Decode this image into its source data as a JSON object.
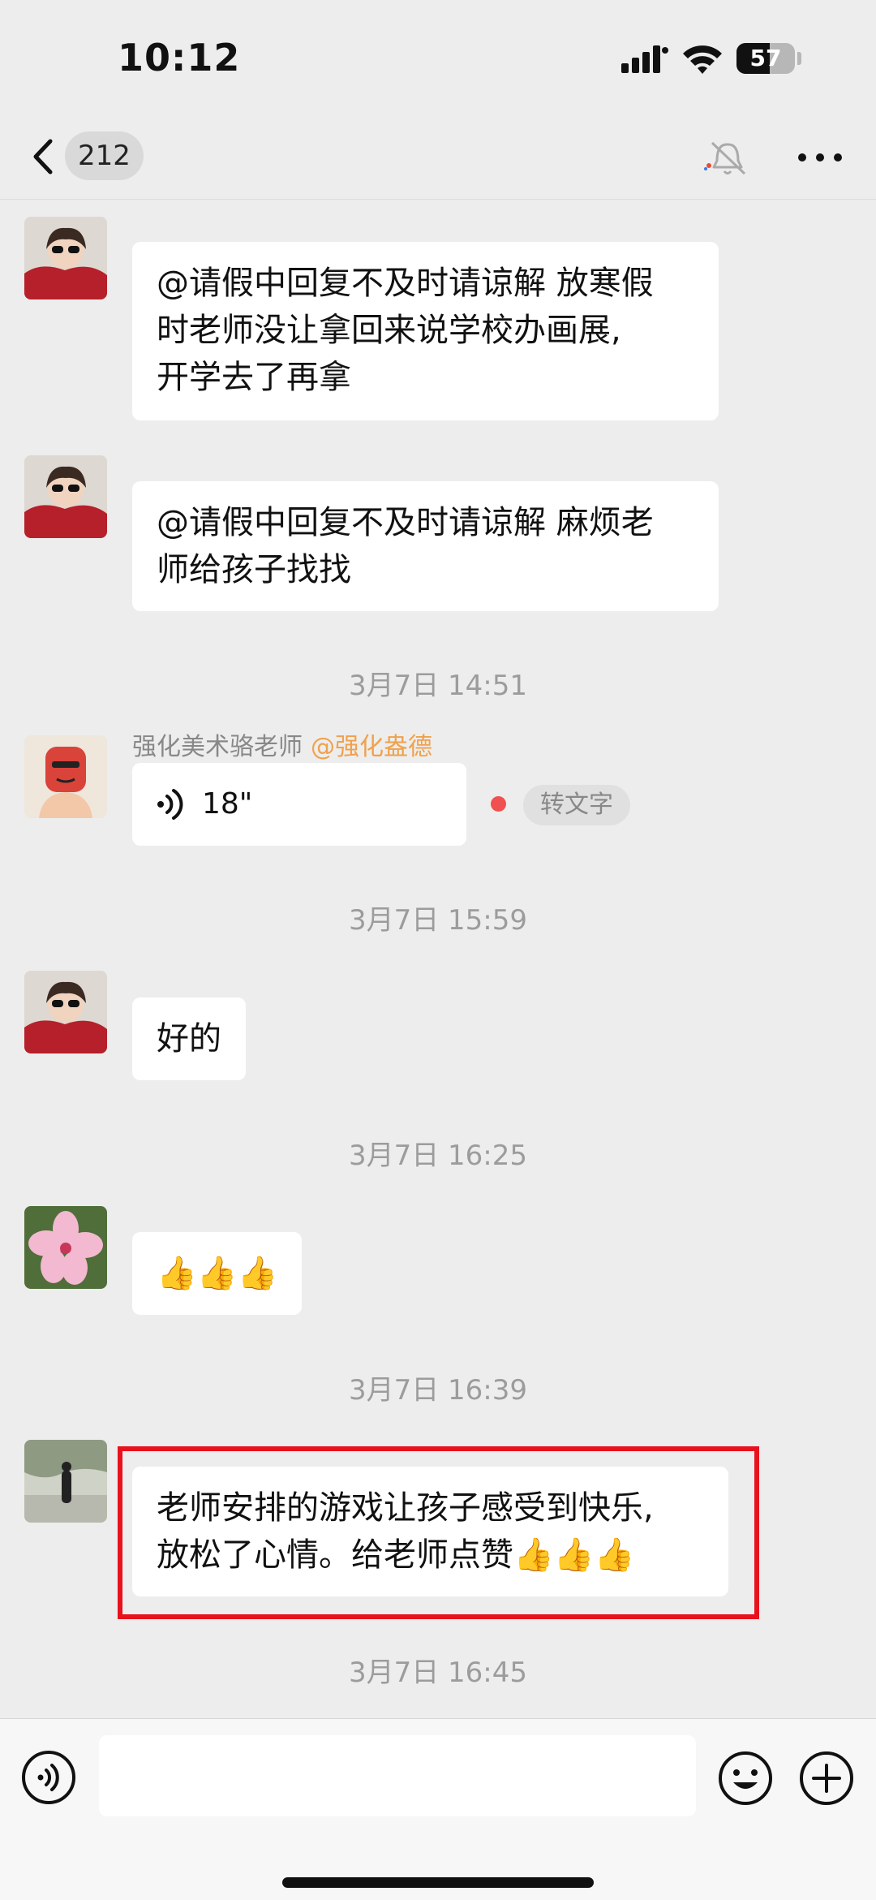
{
  "status_bar": {
    "time": "10:12",
    "battery": "57",
    "battery_level": 0.57
  },
  "header": {
    "unread_count": "212"
  },
  "messages": [
    {
      "text": "@请假中回复不及时请谅解 放寒假\n时老师没让拿回来说学校办画展,\n开学去了再拿"
    },
    {
      "text": "@请假中回复不及时请谅解 麻烦老\n师给孩子找找"
    },
    {
      "time": "3月7日 14:51"
    },
    {
      "sender": "强化美术骆老师",
      "mention": "@强化盎德",
      "voice_duration": "18\"",
      "to_text_label": "转文字"
    },
    {
      "time": "3月7日 15:59"
    },
    {
      "text": "好的"
    },
    {
      "time": "3月7日 16:25"
    },
    {
      "text": "👍👍👍"
    },
    {
      "time": "3月7日 16:39"
    },
    {
      "text": "老师安排的游戏让孩子感受到快乐,\n放松了心情。给老师点赞👍👍👍"
    },
    {
      "time": "3月7日 16:45"
    }
  ],
  "colors": {
    "background": "#ededed",
    "bubble": "#ffffff",
    "mention": "#f0a14b",
    "highlight": "#e8121c",
    "unread_dot": "#f05050"
  }
}
